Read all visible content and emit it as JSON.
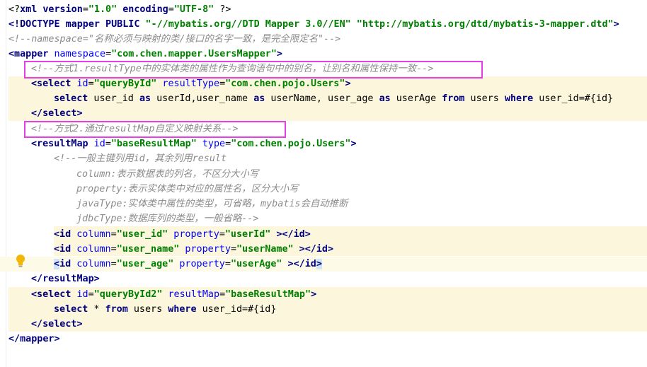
{
  "lines": {
    "l1": {
      "a": "<?",
      "b": "xml version",
      "c": "=",
      "d": "\"1.0\"",
      "e": " encoding",
      "f": "=",
      "g": "\"UTF-8\"",
      "h": " ?>"
    },
    "l2": {
      "a": "<!DOCTYPE",
      "b": " mapper",
      "c": " PUBLIC ",
      "d": "\"-//mybatis.org//DTD Mapper 3.0//EN\"",
      "e": " ",
      "f": "\"http://mybatis.org/dtd/mybatis-3-mapper.dtd\"",
      "g": ">"
    },
    "l3": "<!--namespace=\"名称必须与映射的类/接口的名字一致，是完全限定名\"-->",
    "l4": {
      "a": "<mapper",
      "b": " namespace",
      "c": "=",
      "d": "\"com.chen.mapper.UsersMapper\"",
      "e": ">"
    },
    "l5": "<!--方式1.resultType中的实体类的属性作为查询语句中的别名，让别名和属性保持一致-->",
    "l6": {
      "a": "<select",
      "b": " id",
      "c": "=",
      "d": "\"queryById\"",
      "e": " resultType",
      "f": "=",
      "g": "\"com.chen.pojo.Users\"",
      "h": ">"
    },
    "l7": {
      "a": "select",
      "b": " user_id ",
      "c": "as",
      "d": " userId,user_name ",
      "e": "as",
      "f": " userName, user_age ",
      "g": "as",
      "h": " userAge ",
      "i": "from",
      "j": " users ",
      "k": "where",
      "l": " user_id=#{id}"
    },
    "l8": "</select>",
    "l9": "<!--方式2.通过resultMap自定义映射关系-->",
    "l10": {
      "a": "<resultMap",
      "b": " id",
      "c": "=",
      "d": "\"baseResultMap\"",
      "e": " type",
      "f": "=",
      "g": "\"com.chen.pojo.Users\"",
      "h": ">"
    },
    "l11": "<!--一般主键列用id，其余列用result",
    "l12": "column:表示数据表的列名，不区分大小写",
    "l13": "property:表示实体类中对应的属性名，区分大小写",
    "l14": "javaType:实体类中属性的类型，可省略，mybatis会自动推断",
    "l15": "jdbcType:数据库列的类型，一般省略-->",
    "l16": {
      "a": "<id",
      "b": " column",
      "c": "=",
      "d": "\"user_id\"",
      "e": " property",
      "f": "=",
      "g": "\"userId\"",
      "h": " ></id>"
    },
    "l17": {
      "a": "<id",
      "b": " column",
      "c": "=",
      "d": "\"user_name\"",
      "e": " property",
      "f": "=",
      "g": "\"userName\"",
      "h": " ></id>"
    },
    "l18": {
      "a": "<",
      "a2": "id",
      "b": " column",
      "c": "=",
      "d": "\"user_age\"",
      "e": " property",
      "f": "=",
      "g": "\"userAge\"",
      "h": " ></id",
      "h2": ">"
    },
    "l19": "</resultMap>",
    "l20": {
      "a": "<select",
      "b": " id",
      "c": "=",
      "d": "\"queryById2\"",
      "e": " resultMap",
      "f": "=",
      "g": "\"baseResultMap\"",
      "h": ">"
    },
    "l21": {
      "a": "select",
      "b": " * ",
      "c": "from",
      "d": " users ",
      "e": "where",
      "f": " user_id=#{id}"
    },
    "l22": "</select>",
    "l23": "</mapper>"
  },
  "colors": {
    "highlight_box": "#e83ee8",
    "block_bg": "#fbf6dc",
    "caret_line_bg": "#fdfbe8"
  },
  "icons": {
    "gutter": "lightbulb-icon"
  }
}
